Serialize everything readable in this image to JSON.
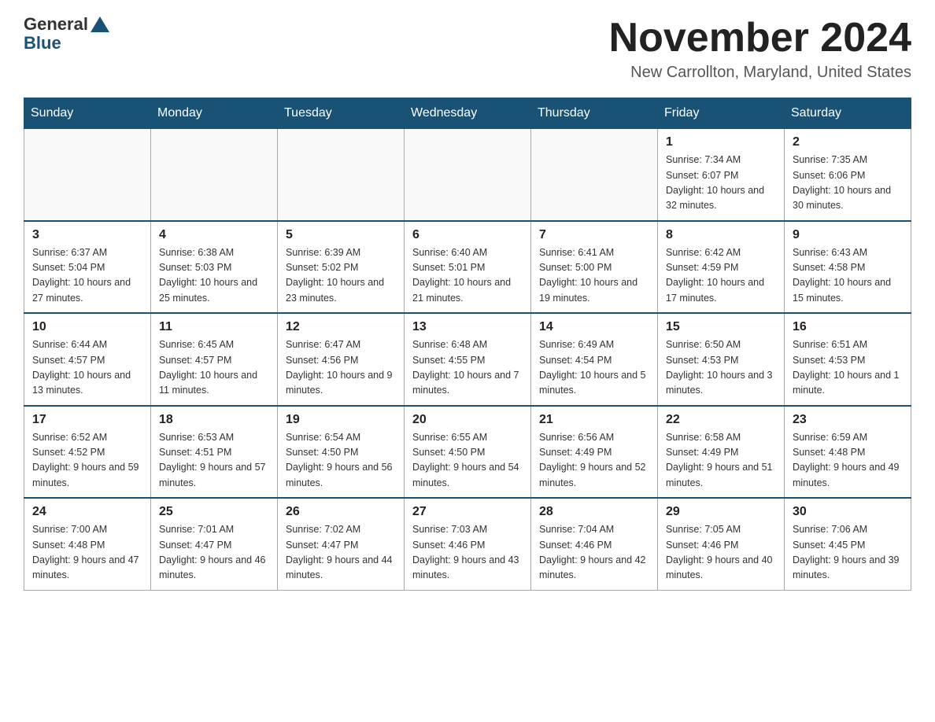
{
  "logo": {
    "general": "General",
    "blue": "Blue"
  },
  "header": {
    "month": "November 2024",
    "location": "New Carrollton, Maryland, United States"
  },
  "weekdays": [
    "Sunday",
    "Monday",
    "Tuesday",
    "Wednesday",
    "Thursday",
    "Friday",
    "Saturday"
  ],
  "weeks": [
    [
      {
        "day": "",
        "info": ""
      },
      {
        "day": "",
        "info": ""
      },
      {
        "day": "",
        "info": ""
      },
      {
        "day": "",
        "info": ""
      },
      {
        "day": "",
        "info": ""
      },
      {
        "day": "1",
        "info": "Sunrise: 7:34 AM\nSunset: 6:07 PM\nDaylight: 10 hours and 32 minutes."
      },
      {
        "day": "2",
        "info": "Sunrise: 7:35 AM\nSunset: 6:06 PM\nDaylight: 10 hours and 30 minutes."
      }
    ],
    [
      {
        "day": "3",
        "info": "Sunrise: 6:37 AM\nSunset: 5:04 PM\nDaylight: 10 hours and 27 minutes."
      },
      {
        "day": "4",
        "info": "Sunrise: 6:38 AM\nSunset: 5:03 PM\nDaylight: 10 hours and 25 minutes."
      },
      {
        "day": "5",
        "info": "Sunrise: 6:39 AM\nSunset: 5:02 PM\nDaylight: 10 hours and 23 minutes."
      },
      {
        "day": "6",
        "info": "Sunrise: 6:40 AM\nSunset: 5:01 PM\nDaylight: 10 hours and 21 minutes."
      },
      {
        "day": "7",
        "info": "Sunrise: 6:41 AM\nSunset: 5:00 PM\nDaylight: 10 hours and 19 minutes."
      },
      {
        "day": "8",
        "info": "Sunrise: 6:42 AM\nSunset: 4:59 PM\nDaylight: 10 hours and 17 minutes."
      },
      {
        "day": "9",
        "info": "Sunrise: 6:43 AM\nSunset: 4:58 PM\nDaylight: 10 hours and 15 minutes."
      }
    ],
    [
      {
        "day": "10",
        "info": "Sunrise: 6:44 AM\nSunset: 4:57 PM\nDaylight: 10 hours and 13 minutes."
      },
      {
        "day": "11",
        "info": "Sunrise: 6:45 AM\nSunset: 4:57 PM\nDaylight: 10 hours and 11 minutes."
      },
      {
        "day": "12",
        "info": "Sunrise: 6:47 AM\nSunset: 4:56 PM\nDaylight: 10 hours and 9 minutes."
      },
      {
        "day": "13",
        "info": "Sunrise: 6:48 AM\nSunset: 4:55 PM\nDaylight: 10 hours and 7 minutes."
      },
      {
        "day": "14",
        "info": "Sunrise: 6:49 AM\nSunset: 4:54 PM\nDaylight: 10 hours and 5 minutes."
      },
      {
        "day": "15",
        "info": "Sunrise: 6:50 AM\nSunset: 4:53 PM\nDaylight: 10 hours and 3 minutes."
      },
      {
        "day": "16",
        "info": "Sunrise: 6:51 AM\nSunset: 4:53 PM\nDaylight: 10 hours and 1 minute."
      }
    ],
    [
      {
        "day": "17",
        "info": "Sunrise: 6:52 AM\nSunset: 4:52 PM\nDaylight: 9 hours and 59 minutes."
      },
      {
        "day": "18",
        "info": "Sunrise: 6:53 AM\nSunset: 4:51 PM\nDaylight: 9 hours and 57 minutes."
      },
      {
        "day": "19",
        "info": "Sunrise: 6:54 AM\nSunset: 4:50 PM\nDaylight: 9 hours and 56 minutes."
      },
      {
        "day": "20",
        "info": "Sunrise: 6:55 AM\nSunset: 4:50 PM\nDaylight: 9 hours and 54 minutes."
      },
      {
        "day": "21",
        "info": "Sunrise: 6:56 AM\nSunset: 4:49 PM\nDaylight: 9 hours and 52 minutes."
      },
      {
        "day": "22",
        "info": "Sunrise: 6:58 AM\nSunset: 4:49 PM\nDaylight: 9 hours and 51 minutes."
      },
      {
        "day": "23",
        "info": "Sunrise: 6:59 AM\nSunset: 4:48 PM\nDaylight: 9 hours and 49 minutes."
      }
    ],
    [
      {
        "day": "24",
        "info": "Sunrise: 7:00 AM\nSunset: 4:48 PM\nDaylight: 9 hours and 47 minutes."
      },
      {
        "day": "25",
        "info": "Sunrise: 7:01 AM\nSunset: 4:47 PM\nDaylight: 9 hours and 46 minutes."
      },
      {
        "day": "26",
        "info": "Sunrise: 7:02 AM\nSunset: 4:47 PM\nDaylight: 9 hours and 44 minutes."
      },
      {
        "day": "27",
        "info": "Sunrise: 7:03 AM\nSunset: 4:46 PM\nDaylight: 9 hours and 43 minutes."
      },
      {
        "day": "28",
        "info": "Sunrise: 7:04 AM\nSunset: 4:46 PM\nDaylight: 9 hours and 42 minutes."
      },
      {
        "day": "29",
        "info": "Sunrise: 7:05 AM\nSunset: 4:46 PM\nDaylight: 9 hours and 40 minutes."
      },
      {
        "day": "30",
        "info": "Sunrise: 7:06 AM\nSunset: 4:45 PM\nDaylight: 9 hours and 39 minutes."
      }
    ]
  ]
}
